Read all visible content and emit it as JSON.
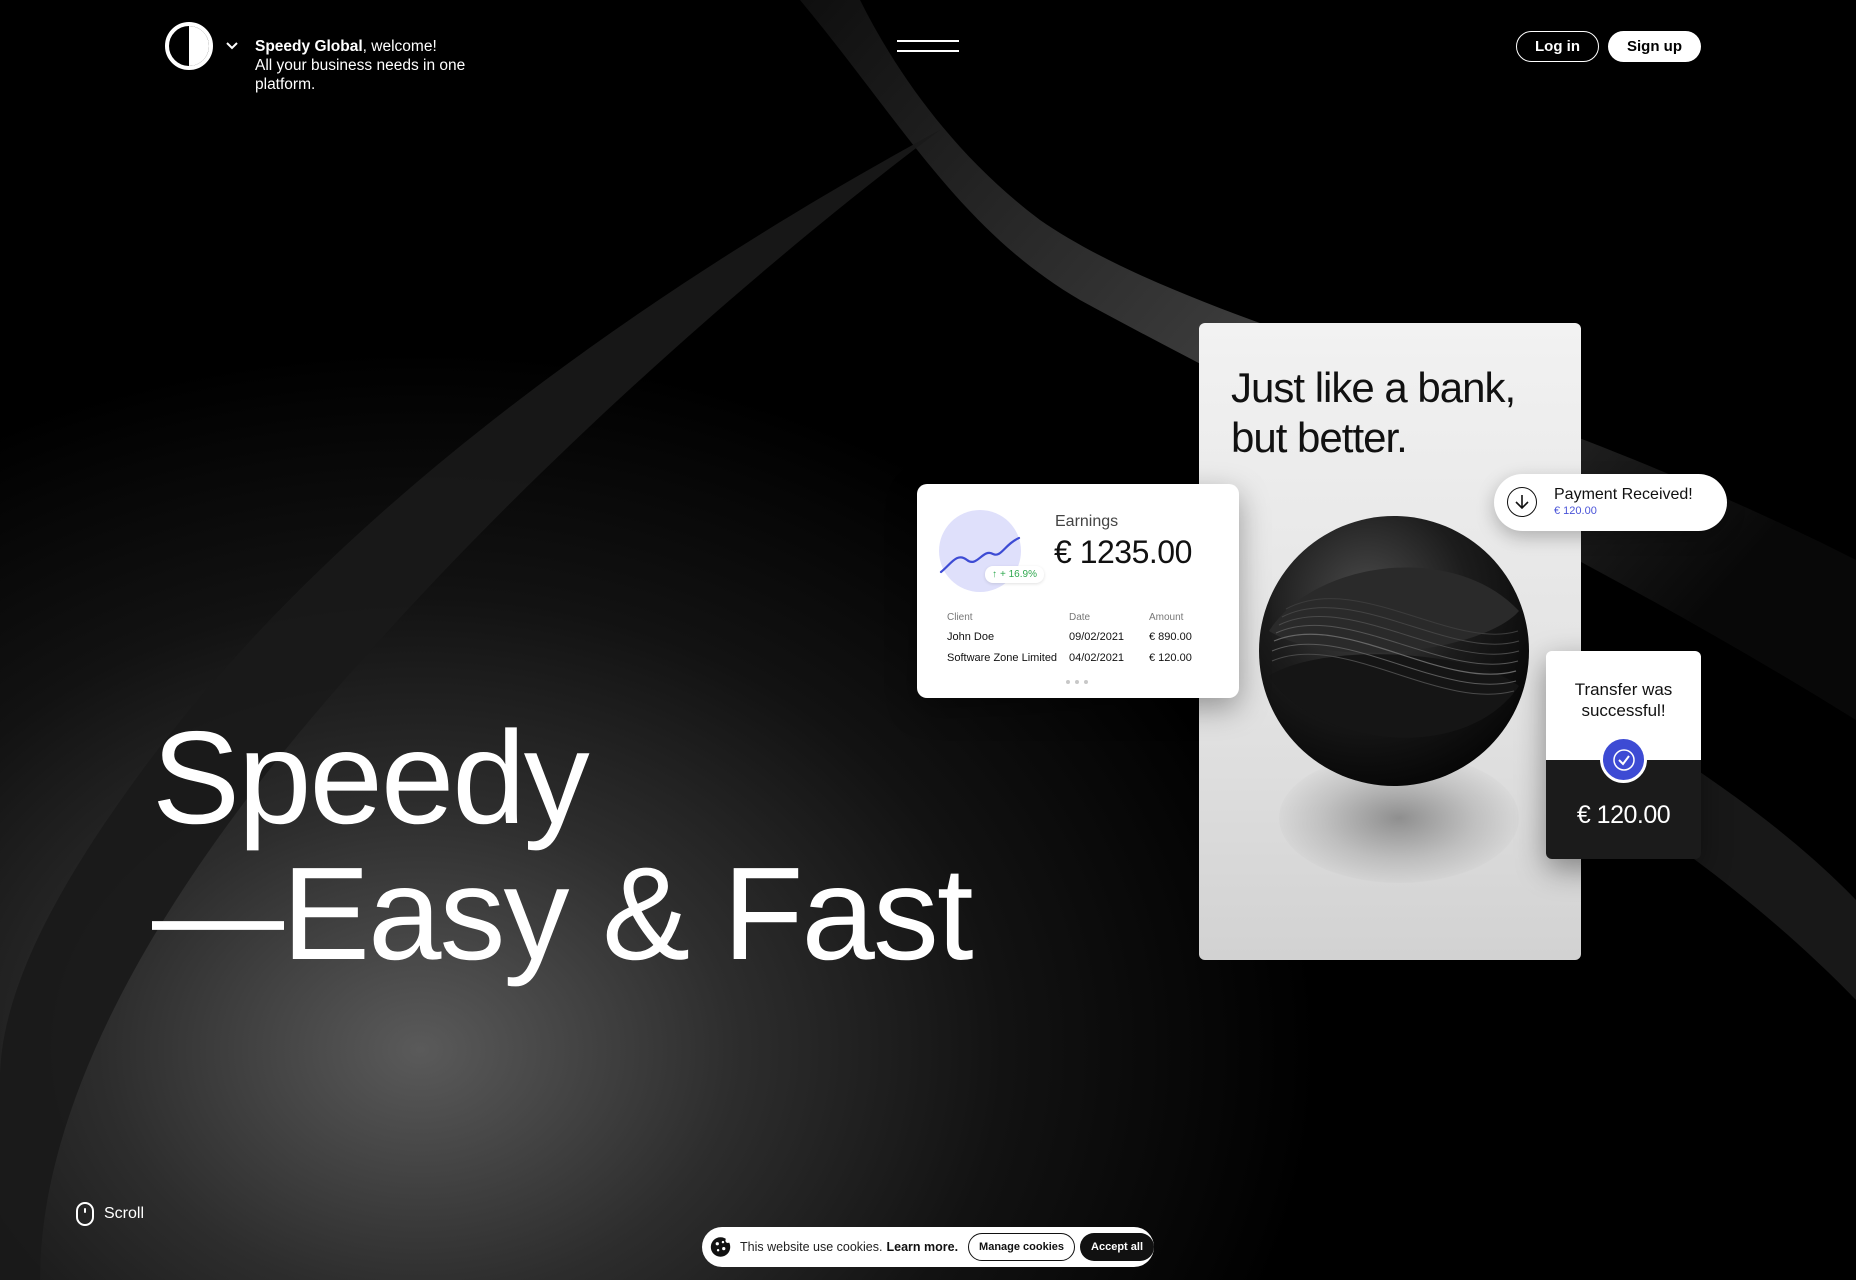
{
  "header": {
    "brand": "Speedy Global",
    "greeting": ", welcome!",
    "tagline": "All your business needs in one platform.",
    "login_label": "Log in",
    "signup_label": "Sign up"
  },
  "hero": {
    "line1": "Speedy",
    "line2": "—Easy & Fast"
  },
  "bank_card": {
    "headline": "Just like a bank, but better."
  },
  "earnings_card": {
    "label": "Earnings",
    "value": "€ 1235.00",
    "growth": "+ 16.9%",
    "columns": [
      "Client",
      "Date",
      "Amount"
    ],
    "rows": [
      {
        "client": "John Doe",
        "date": "09/02/2021",
        "amount": "€ 890.00"
      },
      {
        "client": "Software Zone Limited",
        "date": "04/02/2021",
        "amount": "€ 120.00"
      }
    ]
  },
  "payment_pill": {
    "title": "Payment Received!",
    "amount": "€ 120.00"
  },
  "transfer_card": {
    "message": "Transfer was successful!",
    "amount": "€ 120.00"
  },
  "scroll": {
    "label": "Scroll"
  },
  "cookie_bar": {
    "text": "This website use cookies.",
    "link": "Learn more.",
    "manage_label": "Manage cookies",
    "accept_label": "Accept all"
  },
  "colors": {
    "accent": "#3d4bd4",
    "growth": "#2fa84f",
    "chart_bg": "#dfe0fb"
  }
}
